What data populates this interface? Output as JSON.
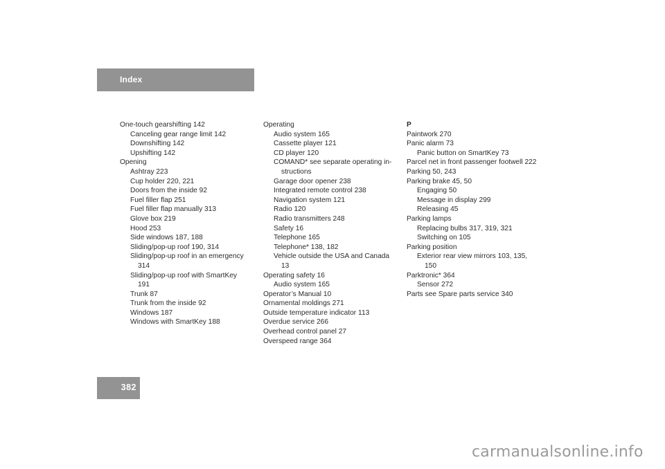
{
  "header": {
    "title": "Index"
  },
  "page_number": "382",
  "columns": [
    {
      "entries": [
        {
          "text": "One-touch gearshifting 142",
          "level": 0
        },
        {
          "text": "Canceling gear range limit 142",
          "level": 1
        },
        {
          "text": "Downshifting 142",
          "level": 1
        },
        {
          "text": "Upshifting 142",
          "level": 1
        },
        {
          "text": "Opening",
          "level": 0
        },
        {
          "text": "Ashtray 223",
          "level": 1
        },
        {
          "text": "Cup holder 220, 221",
          "level": 1
        },
        {
          "text": "Doors from the inside 92",
          "level": 1
        },
        {
          "text": "Fuel filler flap 251",
          "level": 1
        },
        {
          "text": "Fuel filler flap manually 313",
          "level": 1
        },
        {
          "text": "Glove box 219",
          "level": 1
        },
        {
          "text": "Hood 253",
          "level": 1
        },
        {
          "text": "Side windows 187, 188",
          "level": 1
        },
        {
          "text": "Sliding/pop-up roof 190, 314",
          "level": 1
        },
        {
          "text": "Sliding/pop-up roof in an emergency",
          "level": 1
        },
        {
          "text": "314",
          "level": 1,
          "continuation": true
        },
        {
          "text": "Sliding/pop-up roof with SmartKey",
          "level": 1
        },
        {
          "text": "191",
          "level": 1,
          "continuation": true
        },
        {
          "text": "Trunk 87",
          "level": 1
        },
        {
          "text": "Trunk from the inside 92",
          "level": 1
        },
        {
          "text": "Windows 187",
          "level": 1
        },
        {
          "text": "Windows with SmartKey 188",
          "level": 1
        }
      ]
    },
    {
      "entries": [
        {
          "text": "Operating",
          "level": 0
        },
        {
          "text": "Audio system 165",
          "level": 1
        },
        {
          "text": "Cassette player 121",
          "level": 1
        },
        {
          "text": "CD player 120",
          "level": 1
        },
        {
          "text": "COMAND* see separate operating in-",
          "level": 1
        },
        {
          "text": "structions",
          "level": 1,
          "continuation": true
        },
        {
          "text": "Garage door opener 238",
          "level": 1
        },
        {
          "text": "Integrated remote control 238",
          "level": 1
        },
        {
          "text": "Navigation system 121",
          "level": 1
        },
        {
          "text": "Radio 120",
          "level": 1
        },
        {
          "text": "Radio transmitters 248",
          "level": 1
        },
        {
          "text": "Safety 16",
          "level": 1
        },
        {
          "text": "Telephone 165",
          "level": 1
        },
        {
          "text": "Telephone* 138, 182",
          "level": 1
        },
        {
          "text": "Vehicle outside the USA and Canada",
          "level": 1
        },
        {
          "text": "13",
          "level": 1,
          "continuation": true
        },
        {
          "text": "Operating safety 16",
          "level": 0
        },
        {
          "text": "Audio system 165",
          "level": 1
        },
        {
          "text": "Operator’s Manual 10",
          "level": 0
        },
        {
          "text": "Ornamental moldings 271",
          "level": 0
        },
        {
          "text": "Outside temperature indicator 113",
          "level": 0
        },
        {
          "text": "Overdue service 266",
          "level": 0
        },
        {
          "text": "Overhead control panel 27",
          "level": 0
        },
        {
          "text": "Overspeed range 364",
          "level": 0
        }
      ]
    },
    {
      "entries": [
        {
          "text": "P",
          "level": 0,
          "heading": true
        },
        {
          "text": "Paintwork 270",
          "level": 0
        },
        {
          "text": "Panic alarm 73",
          "level": 0
        },
        {
          "text": "Panic button on SmartKey 73",
          "level": 1
        },
        {
          "text": "Parcel net in front passenger footwell 222",
          "level": 0
        },
        {
          "text": "Parking 50, 243",
          "level": 0
        },
        {
          "text": "Parking brake 45, 50",
          "level": 0
        },
        {
          "text": "Engaging 50",
          "level": 1
        },
        {
          "text": "Message in display 299",
          "level": 1
        },
        {
          "text": "Releasing 45",
          "level": 1
        },
        {
          "text": "Parking lamps",
          "level": 0
        },
        {
          "text": "Replacing bulbs 317, 319, 321",
          "level": 1
        },
        {
          "text": "Switching on 105",
          "level": 1
        },
        {
          "text": "Parking position",
          "level": 0
        },
        {
          "text": "Exterior rear view mirrors 103, 135,",
          "level": 1
        },
        {
          "text": "150",
          "level": 1,
          "continuation": true
        },
        {
          "text": "Parktronic* 364",
          "level": 0
        },
        {
          "text": "Sensor 272",
          "level": 1
        },
        {
          "text": "Parts see Spare parts service 340",
          "level": 0
        }
      ]
    }
  ],
  "watermark": "carmanualsonline.info"
}
